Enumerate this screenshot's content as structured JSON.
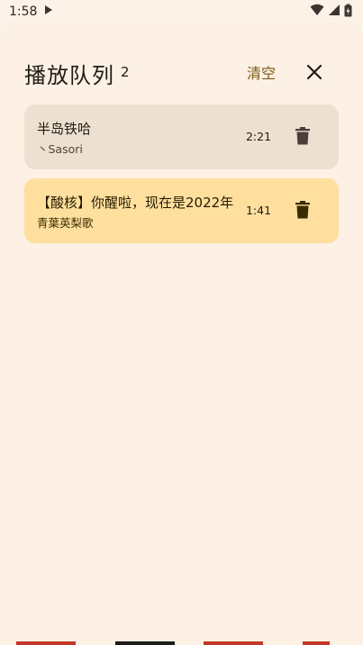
{
  "status_bar": {
    "time": "1:58",
    "icons": [
      "play-icon",
      "wifi-icon",
      "signal-icon",
      "battery-charging-icon"
    ]
  },
  "queue_header": {
    "title": "播放队列",
    "count": "2",
    "clear_label": "清空",
    "close_icon": "close-icon"
  },
  "queue": {
    "items": [
      {
        "title": "半岛铁哈",
        "artist": "丶Sasori",
        "duration": "2:21",
        "playing": false
      },
      {
        "title": "【酸核】你醒啦，现在是2022年",
        "artist": "青葉英梨歌",
        "duration": "1:41",
        "playing": true
      }
    ]
  },
  "colors": {
    "background": "#fdf0e4",
    "item_normal": "#ede0d0",
    "item_playing": "#ffdf9e",
    "accent": "#7a5a14"
  }
}
